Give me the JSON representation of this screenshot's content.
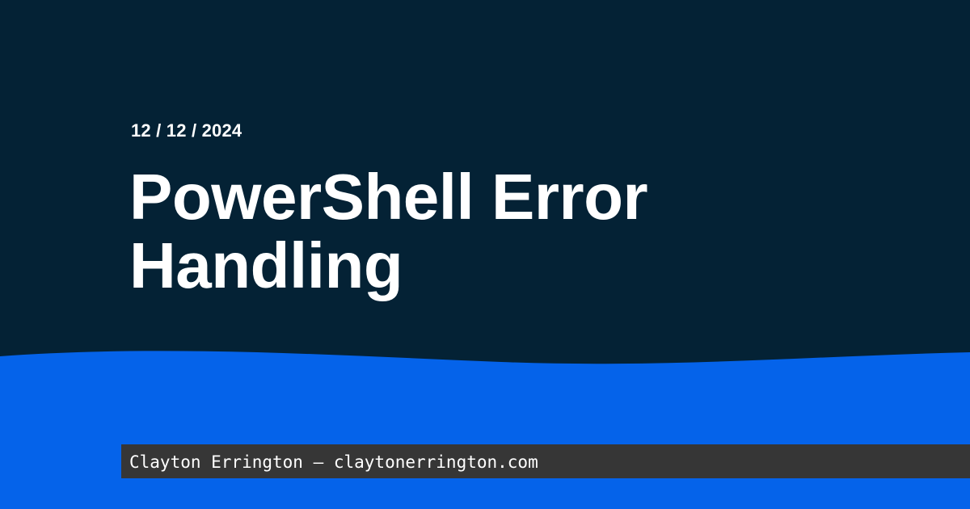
{
  "date": "12 / 12 / 2024",
  "title": "PowerShell Error Handling",
  "footer": {
    "text": "Clayton Errington — claytonerrington.com"
  },
  "colors": {
    "background": "#042235",
    "wave": "#0563EA",
    "footer_bar": "#363636",
    "text": "#FFFFFF"
  }
}
